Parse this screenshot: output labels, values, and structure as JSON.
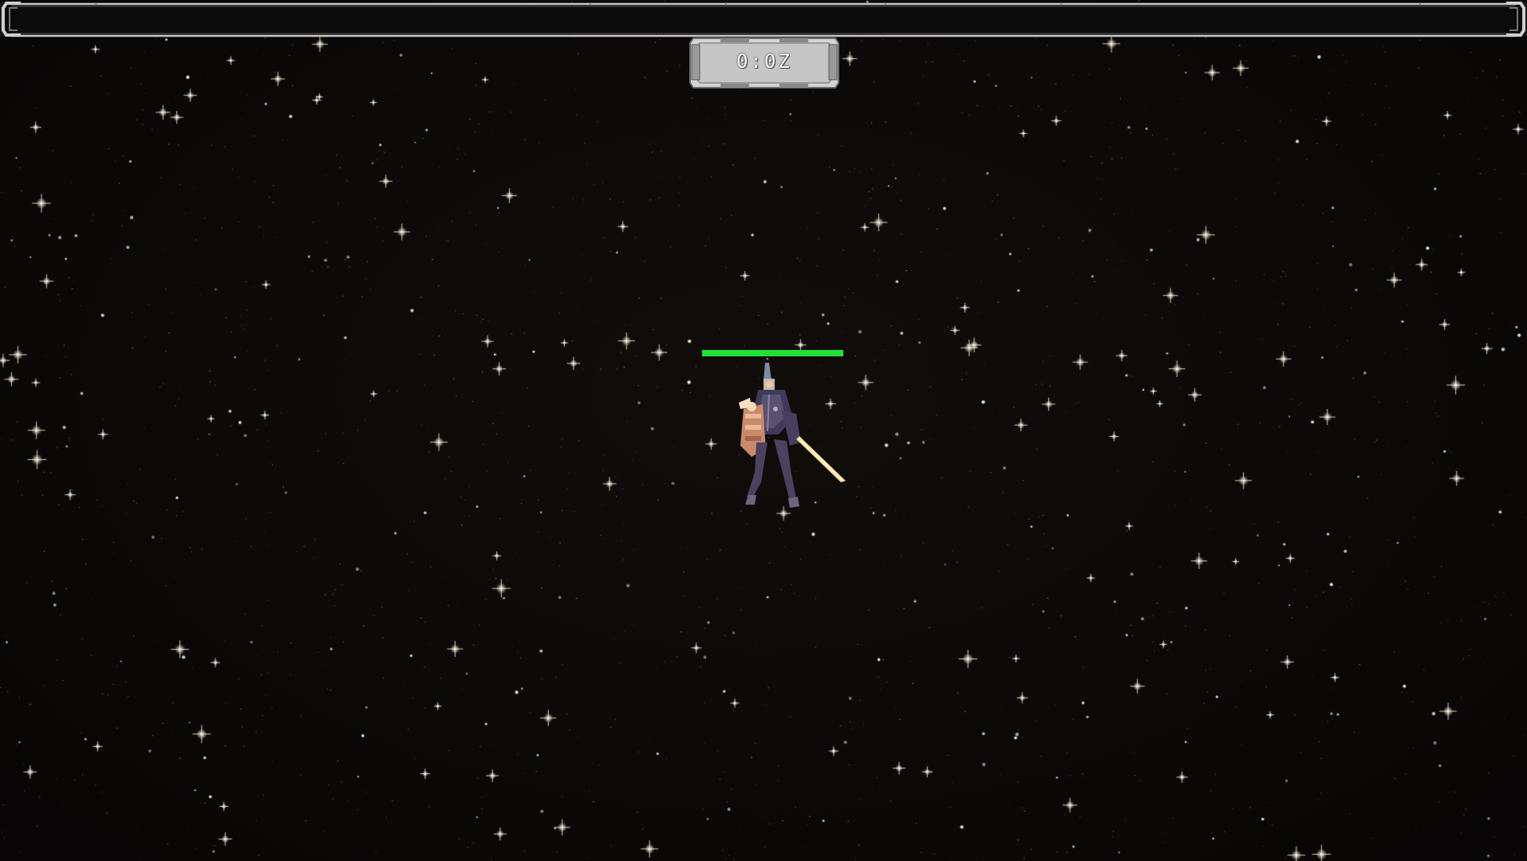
{
  "hud": {
    "timer": "0:0Z",
    "xp_progress": 0,
    "player_health": 1.0
  },
  "colors": {
    "background": "#0a0807",
    "health": "#22e033",
    "frame": "#c8c8c8",
    "timer_panel": "#d9d9d9"
  },
  "icons": {
    "player": "mech-robot-sprite",
    "stars": "sparkle-star"
  }
}
